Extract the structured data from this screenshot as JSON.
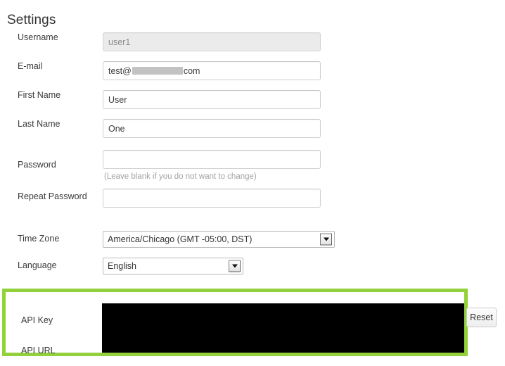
{
  "page": {
    "title": "Settings"
  },
  "colors": {
    "highlight_green": "#93d13c",
    "redaction_black": "#000000",
    "redaction_gray": "#c2c2c2",
    "text": "#3a3a3a",
    "hint_text": "#a3a3a3",
    "disabled_bg": "#ebebeb"
  },
  "form": {
    "fields": [
      {
        "id": "username",
        "label": "Username",
        "type": "text",
        "value": "user1",
        "placeholder": "",
        "disabled": true
      },
      {
        "id": "email",
        "label": "E-mail",
        "type": "text-redacted",
        "value_prefix": "test@",
        "value_redacted": "redacted",
        "value_suffix": "com",
        "placeholder": "",
        "disabled": false
      },
      {
        "id": "first-name",
        "label": "First Name",
        "type": "text",
        "value": "User",
        "placeholder": "",
        "disabled": false
      },
      {
        "id": "last-name",
        "label": "Last Name",
        "type": "text",
        "value": "One",
        "placeholder": "",
        "disabled": false
      },
      {
        "id": "password",
        "label": "Password",
        "type": "password",
        "value": "",
        "placeholder": "",
        "disabled": false,
        "hint": "(Leave blank if you do not want to change)"
      },
      {
        "id": "repeat-password",
        "label": "Repeat Password",
        "type": "password",
        "value": "",
        "placeholder": "",
        "disabled": false
      }
    ],
    "selects": [
      {
        "id": "timezone",
        "label": "Time Zone",
        "selected": "America/Chicago (GMT -05:00, DST)",
        "arrow_icon": "chevron-down-icon"
      },
      {
        "id": "language",
        "label": "Language",
        "selected": "English",
        "arrow_icon": "chevron-down-icon"
      }
    ]
  },
  "api_section": {
    "highlighted": true,
    "rows": [
      {
        "id": "api-key",
        "label": "API Key",
        "value": "",
        "redacted": true
      },
      {
        "id": "api-url",
        "label": "API URL",
        "value": "",
        "redacted": true
      }
    ]
  },
  "actions": {
    "reset_label": "Reset"
  }
}
